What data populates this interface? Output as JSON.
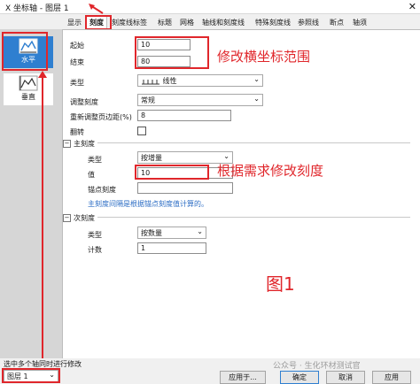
{
  "window": {
    "title": "X 坐标轴 - 图层 1",
    "close_icon": "close-icon"
  },
  "tabs": [
    "显示",
    "刻度",
    "刻度线标签",
    "标题",
    "网格",
    "轴线和刻度线",
    "特殊刻度线",
    "参照线",
    "断点",
    "轴须"
  ],
  "nav": {
    "horizontal_label": "水平",
    "vertical_label": "垂直"
  },
  "scale": {
    "from_label": "起始",
    "from_value": "10",
    "to_label": "结束",
    "to_value": "80",
    "type_label": "类型",
    "type_value": "线性",
    "rescale_label": "调整刻度",
    "rescale_value": "常规",
    "rescale_margin_label": "重新调整页边距(%)",
    "rescale_margin_value": "8",
    "flip_label": "翻转"
  },
  "major": {
    "section_label": "主刻度",
    "type_label": "类型",
    "type_value": "按增量",
    "value_label": "值",
    "value_value": "10",
    "anchor_label": "锚点刻度",
    "note": "主刻度间隔是根据锚点刻度值计算的。"
  },
  "minor": {
    "section_label": "次刻度",
    "type_label": "类型",
    "type_value": "按数量",
    "count_label": "计数",
    "count_value": "1"
  },
  "annotations": {
    "range_note": "修改横坐标范围",
    "tick_note": "根据需求修改刻度",
    "figure_label": "图1"
  },
  "bottom": {
    "hint": "选中多个轴同时进行修改",
    "layer_value": "图层 1",
    "apply_to_label": "应用于...",
    "ok_label": "确定",
    "cancel_label": "取消",
    "apply_label": "应用",
    "watermark": "公众号 · 生化环材测试官"
  },
  "colors": {
    "annotation_red": "#e0262b",
    "selected_blue": "#2f7fd0",
    "note_blue": "#2b6cc4"
  }
}
